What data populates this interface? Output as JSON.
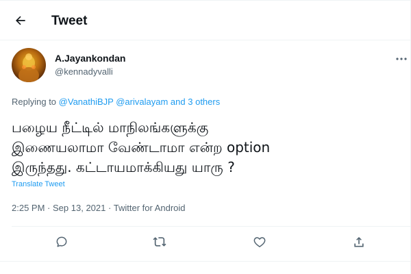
{
  "header": {
    "title": "Tweet",
    "back_icon": "arrow-left-icon"
  },
  "author": {
    "name": "A.Jayankondan",
    "handle": "@kennadyvalli"
  },
  "replying": {
    "prefix": "Replying to",
    "mention1": "@VanathiBJP",
    "mention2": "@arivalayam",
    "and_text": "and",
    "others": "3 others"
  },
  "tweet": {
    "line1": "பழைய நீட்டில் மாநிலங்களுக்கு",
    "line2": "இணையலாமா வேண்டாமா என்ற option",
    "line3": "இருந்தது. கட்டாயமாக்கியது யாரு ?"
  },
  "translate_label": "Translate Tweet",
  "meta": {
    "time": "2:25 PM",
    "date": "Sep 13, 2021",
    "source": "Twitter for Android",
    "separator": "·"
  },
  "actions": [
    "reply-icon",
    "retweet-icon",
    "like-icon",
    "share-icon"
  ],
  "colors": {
    "accent": "#1d9bf0",
    "text": "#0f1419",
    "secondary": "#536471",
    "border": "#eff3f4"
  }
}
